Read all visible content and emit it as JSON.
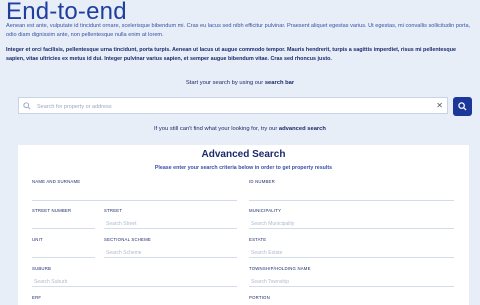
{
  "header": {
    "title": "End-to-end",
    "paragraph1": "Aenean est ante, vulputate id tincidunt ornare, scelerisque bibendum mi. Cras eu lacus sed nibh efficitur pulvinar. Praesent aliquet egestas varius. Ut egestas, mi convallis sollicitudin porta, odio diam dignissim ante, non pellentesque nulla enim at lorem.",
    "paragraph2": "Integer et orci facilisis, pellentesque urna tincidunt, porta turpis. Aenean ut lacus ut augue commodo tempor. Mauris hendrerit, turpis a sagittis imperdiet, risus mi pellentesque sapien, vitae ultricies ex metus id dui. Integer pulvinar varius sapien, et semper augue bibendum vitae. Cras sed rhoncus justo."
  },
  "search": {
    "intro_prefix": "Start your search by using our ",
    "intro_bold": "search bar",
    "placeholder": "Search for property or address",
    "clear_icon": "close-icon",
    "button_icon": "search-icon"
  },
  "advanced_intro": {
    "prefix": "If you still can't find what your looking for, try our ",
    "bold": "advanced search"
  },
  "advanced": {
    "title": "Advanced Search",
    "subtitle": "Please enter your search criteria below in order to get property results",
    "fields": {
      "name": {
        "label": "NAME AND SURNAME"
      },
      "id": {
        "label": "ID NUMBER"
      },
      "street_number": {
        "label": "STREET NUMBER"
      },
      "street": {
        "label": "STREET",
        "placeholder": "Search Street"
      },
      "municipality": {
        "label": "MUNICIPALITY",
        "placeholder": "Search Municipality"
      },
      "unit": {
        "label": "UNIT"
      },
      "sectional_scheme": {
        "label": "SECTIONAL SCHEME",
        "placeholder": "Search Scheme"
      },
      "estate": {
        "label": "ESTATE",
        "placeholder": "Search Estate"
      },
      "suburb": {
        "label": "SUBURB",
        "placeholder": "Search Suburb"
      },
      "township": {
        "label": "TOWNSHIP/HOLDING NAME",
        "placeholder": "Search Township"
      },
      "erf": {
        "label": "ERF"
      },
      "portion": {
        "label": "PORTION"
      }
    }
  }
}
